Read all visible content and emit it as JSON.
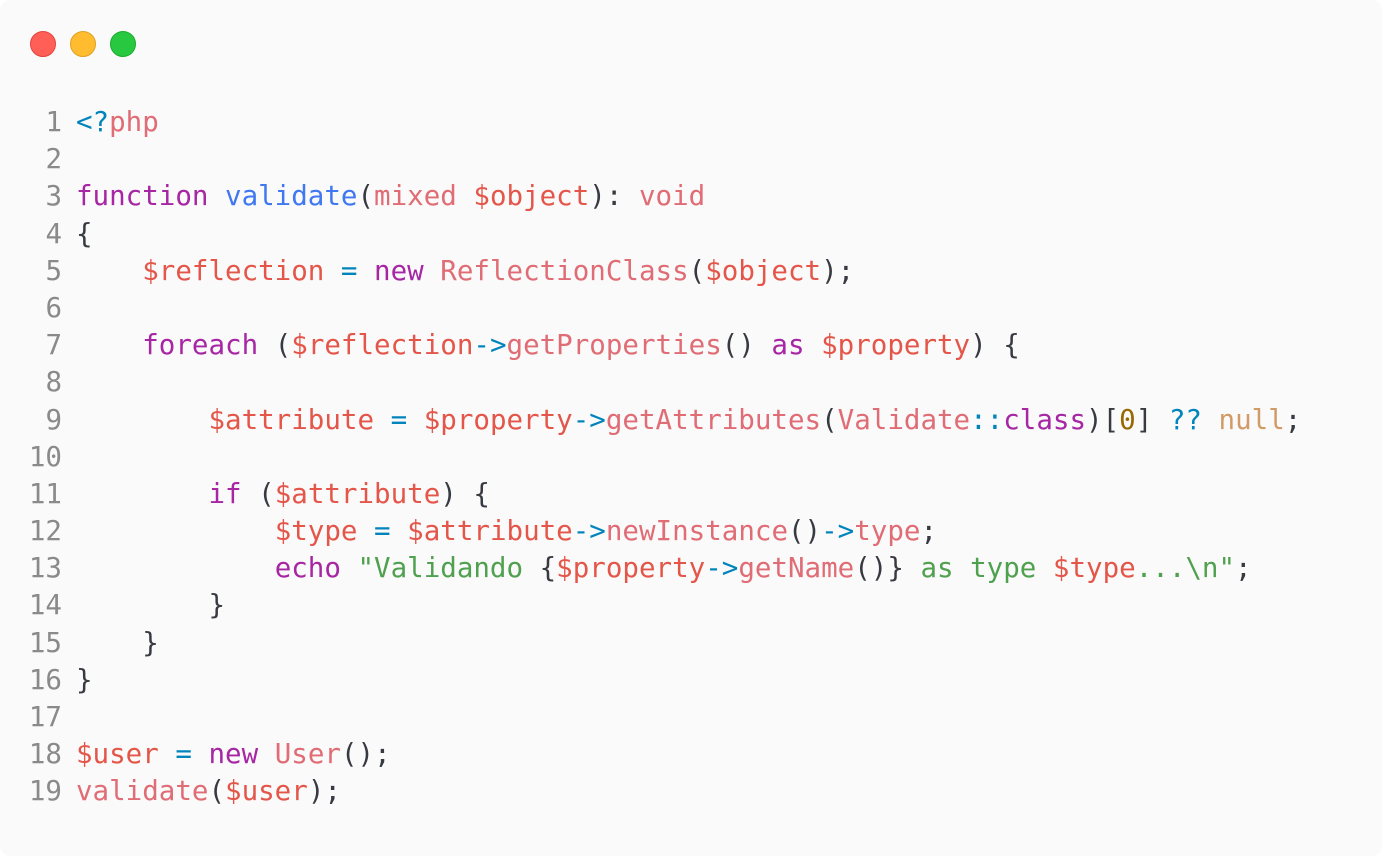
{
  "colors": {
    "background": "#fafafa",
    "close": "#ff5f57",
    "minimize": "#febc2e",
    "zoom": "#28c840",
    "default": "#383a42",
    "keyword": "#a626a4",
    "function": "#4078f2",
    "variable": "#e45649",
    "type": "#e06c75",
    "operator": "#0184bc",
    "string": "#50a14f",
    "number": "#986801",
    "literal": "#d19a66"
  },
  "window_controls": [
    {
      "name": "close",
      "color": "#ff5f57",
      "border": "#e0443e"
    },
    {
      "name": "minimize",
      "color": "#febc2e",
      "border": "#dea123"
    },
    {
      "name": "zoom",
      "color": "#28c840",
      "border": "#1aab29"
    }
  ],
  "code": {
    "language": "php",
    "lines": [
      {
        "n": "1",
        "tokens": [
          [
            "<?",
            "operator"
          ],
          [
            "php",
            "type"
          ]
        ]
      },
      {
        "n": "2",
        "tokens": []
      },
      {
        "n": "3",
        "tokens": [
          [
            "function",
            "keyword"
          ],
          [
            " ",
            "default"
          ],
          [
            "validate",
            "function"
          ],
          [
            "(",
            "default"
          ],
          [
            "mixed",
            "type"
          ],
          [
            " ",
            "default"
          ],
          [
            "$object",
            "variable"
          ],
          [
            "): ",
            "default"
          ],
          [
            "void",
            "type"
          ]
        ]
      },
      {
        "n": "4",
        "tokens": [
          [
            "{",
            "default"
          ]
        ]
      },
      {
        "n": "5",
        "tokens": [
          [
            "    ",
            "default"
          ],
          [
            "$reflection",
            "variable"
          ],
          [
            " ",
            "default"
          ],
          [
            "=",
            "operator"
          ],
          [
            " ",
            "default"
          ],
          [
            "new",
            "keyword"
          ],
          [
            " ",
            "default"
          ],
          [
            "ReflectionClass",
            "type"
          ],
          [
            "(",
            "default"
          ],
          [
            "$object",
            "variable"
          ],
          [
            ");",
            "default"
          ]
        ]
      },
      {
        "n": "6",
        "tokens": []
      },
      {
        "n": "7",
        "tokens": [
          [
            "    ",
            "default"
          ],
          [
            "foreach",
            "keyword"
          ],
          [
            " (",
            "default"
          ],
          [
            "$reflection",
            "variable"
          ],
          [
            "->",
            "operator"
          ],
          [
            "getProperties",
            "type"
          ],
          [
            "() ",
            "default"
          ],
          [
            "as",
            "keyword"
          ],
          [
            " ",
            "default"
          ],
          [
            "$property",
            "variable"
          ],
          [
            ") {",
            "default"
          ]
        ]
      },
      {
        "n": "8",
        "tokens": []
      },
      {
        "n": "9",
        "tokens": [
          [
            "        ",
            "default"
          ],
          [
            "$attribute",
            "variable"
          ],
          [
            " ",
            "default"
          ],
          [
            "=",
            "operator"
          ],
          [
            " ",
            "default"
          ],
          [
            "$property",
            "variable"
          ],
          [
            "->",
            "operator"
          ],
          [
            "getAttributes",
            "type"
          ],
          [
            "(",
            "default"
          ],
          [
            "Validate",
            "type"
          ],
          [
            "::",
            "operator"
          ],
          [
            "class",
            "keyword"
          ],
          [
            ")[",
            "default"
          ],
          [
            "0",
            "number"
          ],
          [
            "] ",
            "default"
          ],
          [
            "??",
            "operator"
          ],
          [
            " ",
            "default"
          ],
          [
            "null",
            "literal"
          ],
          [
            ";",
            "default"
          ]
        ]
      },
      {
        "n": "10",
        "tokens": []
      },
      {
        "n": "11",
        "tokens": [
          [
            "        ",
            "default"
          ],
          [
            "if",
            "keyword"
          ],
          [
            " (",
            "default"
          ],
          [
            "$attribute",
            "variable"
          ],
          [
            ") {",
            "default"
          ]
        ]
      },
      {
        "n": "12",
        "tokens": [
          [
            "            ",
            "default"
          ],
          [
            "$type",
            "variable"
          ],
          [
            " ",
            "default"
          ],
          [
            "=",
            "operator"
          ],
          [
            " ",
            "default"
          ],
          [
            "$attribute",
            "variable"
          ],
          [
            "->",
            "operator"
          ],
          [
            "newInstance",
            "type"
          ],
          [
            "()",
            "default"
          ],
          [
            "->",
            "operator"
          ],
          [
            "type",
            "type"
          ],
          [
            ";",
            "default"
          ]
        ]
      },
      {
        "n": "13",
        "tokens": [
          [
            "            ",
            "default"
          ],
          [
            "echo",
            "keyword"
          ],
          [
            " ",
            "default"
          ],
          [
            "\"Validando ",
            "string"
          ],
          [
            "{",
            "default"
          ],
          [
            "$property",
            "variable"
          ],
          [
            "->",
            "operator"
          ],
          [
            "getName",
            "type"
          ],
          [
            "()}",
            "default"
          ],
          [
            " as type ",
            "string"
          ],
          [
            "$type",
            "variable"
          ],
          [
            "...\\n\"",
            "string"
          ],
          [
            ";",
            "default"
          ]
        ]
      },
      {
        "n": "14",
        "tokens": [
          [
            "        ",
            "default"
          ],
          [
            "}",
            "default"
          ]
        ]
      },
      {
        "n": "15",
        "tokens": [
          [
            "    ",
            "default"
          ],
          [
            "}",
            "default"
          ]
        ]
      },
      {
        "n": "16",
        "tokens": [
          [
            "}",
            "default"
          ]
        ]
      },
      {
        "n": "17",
        "tokens": []
      },
      {
        "n": "18",
        "tokens": [
          [
            "$user",
            "variable"
          ],
          [
            " ",
            "default"
          ],
          [
            "=",
            "operator"
          ],
          [
            " ",
            "default"
          ],
          [
            "new",
            "keyword"
          ],
          [
            " ",
            "default"
          ],
          [
            "User",
            "type"
          ],
          [
            "();",
            "default"
          ]
        ]
      },
      {
        "n": "19",
        "tokens": [
          [
            "validate",
            "type"
          ],
          [
            "(",
            "default"
          ],
          [
            "$user",
            "variable"
          ],
          [
            ");",
            "default"
          ]
        ]
      }
    ]
  }
}
